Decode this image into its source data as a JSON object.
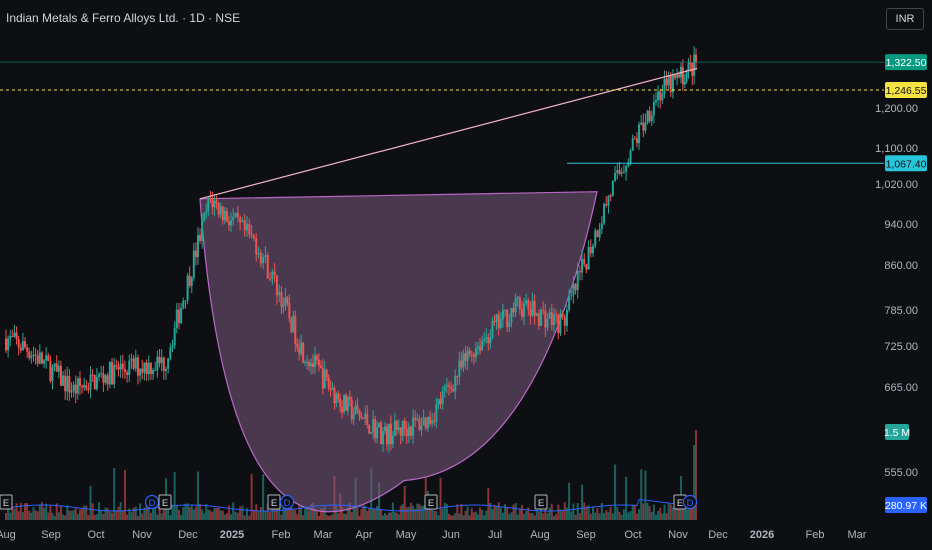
{
  "header": {
    "symbol_title": "Indian Metals & Ferro Alloys Ltd. · 1D · NSE",
    "currency_label": "INR"
  },
  "price_axis": {
    "ticks": [
      "1,200.00",
      "1,100.00",
      "1,020.00",
      "940.00",
      "860.00",
      "785.00",
      "725.00",
      "665.00",
      "555.00"
    ],
    "badges": [
      {
        "name": "last-price",
        "label": "1,322.50",
        "color": "#089981",
        "text_color": "#ffffff"
      },
      {
        "name": "dashed-level",
        "label": "1,246.55",
        "color": "#f5e342",
        "text_color": "#0e0f13"
      },
      {
        "name": "support-level",
        "label": "1,067.40",
        "color": "#26c6da",
        "text_color": "#0e0f13"
      },
      {
        "name": "volume-max",
        "label": "1.5 M",
        "color": "#26a69a",
        "text_color": "#ffffff"
      },
      {
        "name": "volume-ma",
        "label": "280.97 K",
        "color": "#2962ff",
        "text_color": "#ffffff"
      }
    ]
  },
  "time_axis": {
    "labels": [
      "Aug",
      "Sep",
      "Oct",
      "Nov",
      "Dec",
      "2025",
      "Feb",
      "Mar",
      "Apr",
      "May",
      "Jun",
      "Jul",
      "Aug",
      "Sep",
      "Oct",
      "Nov",
      "Dec",
      "2026",
      "Feb",
      "Mar"
    ]
  },
  "event_markers": [
    "E",
    "D",
    "E",
    "E",
    "D",
    "E",
    "E",
    "E",
    "D"
  ],
  "colors": {
    "up": "#26a69a",
    "down": "#ef5350",
    "cup_fill": "#7b5d80",
    "cup_edge": "#ba68c8",
    "trendline": "#f4b6c6",
    "dashed_line": "#f5e342",
    "support_line": "#26c6da",
    "background": "#0e0f13"
  },
  "chart_data": {
    "type": "candlestick",
    "title": "Indian Metals & Ferro Alloys Ltd. · 1D · NSE",
    "y_scale": "log",
    "ylim": [
      530,
      1370
    ],
    "x_range": [
      "2024-08",
      "2026-03"
    ],
    "last_price": 1322.5,
    "annotations": {
      "dashed_horizontal_level": 1246.55,
      "support_horizontal_level": 1067.4,
      "cup_pattern": {
        "left_rim": 990,
        "bottom": 545,
        "right_rim": 1005,
        "start": "2024-12",
        "bottom_month": "2025-05",
        "end": "2025-09"
      },
      "rising_trendline": {
        "from": 990,
        "to": 1305
      }
    },
    "price_path_approx": [
      {
        "period": "2024-08",
        "price": 720
      },
      {
        "period": "2024-09",
        "price": 660
      },
      {
        "period": "2024-10",
        "price": 690
      },
      {
        "period": "2024-11",
        "price": 700
      },
      {
        "period": "2024-12",
        "price": 990
      },
      {
        "period": "2025-01",
        "price": 900
      },
      {
        "period": "2025-02",
        "price": 720
      },
      {
        "period": "2025-03",
        "price": 640
      },
      {
        "period": "2025-04",
        "price": 600
      },
      {
        "period": "2025-05",
        "price": 620
      },
      {
        "period": "2025-06",
        "price": 720
      },
      {
        "period": "2025-07",
        "price": 790
      },
      {
        "period": "2025-08",
        "price": 760
      },
      {
        "period": "2025-09",
        "price": 1000
      },
      {
        "period": "2025-10",
        "price": 1230
      },
      {
        "period": "2025-11",
        "price": 1322.5
      }
    ],
    "volume": {
      "last_max": "1.5 M",
      "moving_average": "280.97 K"
    }
  }
}
